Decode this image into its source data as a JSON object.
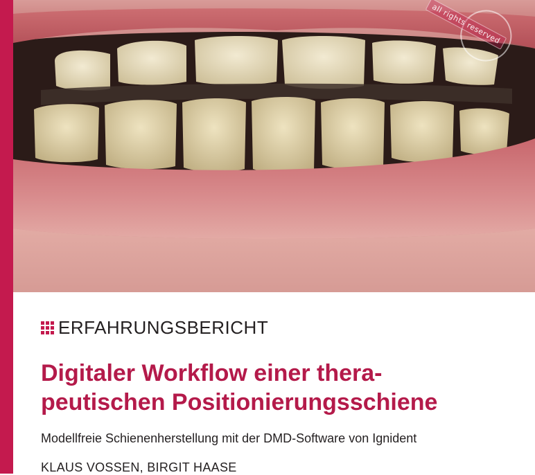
{
  "photo": {
    "watermark": "all rights reserved"
  },
  "category": {
    "label": "ERFAHRUNGSBERICHT",
    "icon": "grid-icon"
  },
  "article": {
    "title_line1": "Digitaler Workflow einer thera-",
    "title_line2": "peutischen Positionierungsschiene",
    "subtitle": "Modellfreie Schienenherstellung mit der DMD-Software von Ignident",
    "authors": "KLAUS VOSSEN, BIRGIT HAASE"
  },
  "colors": {
    "accent": "#c41a4e",
    "title": "#b41a4a",
    "text": "#231f20"
  }
}
